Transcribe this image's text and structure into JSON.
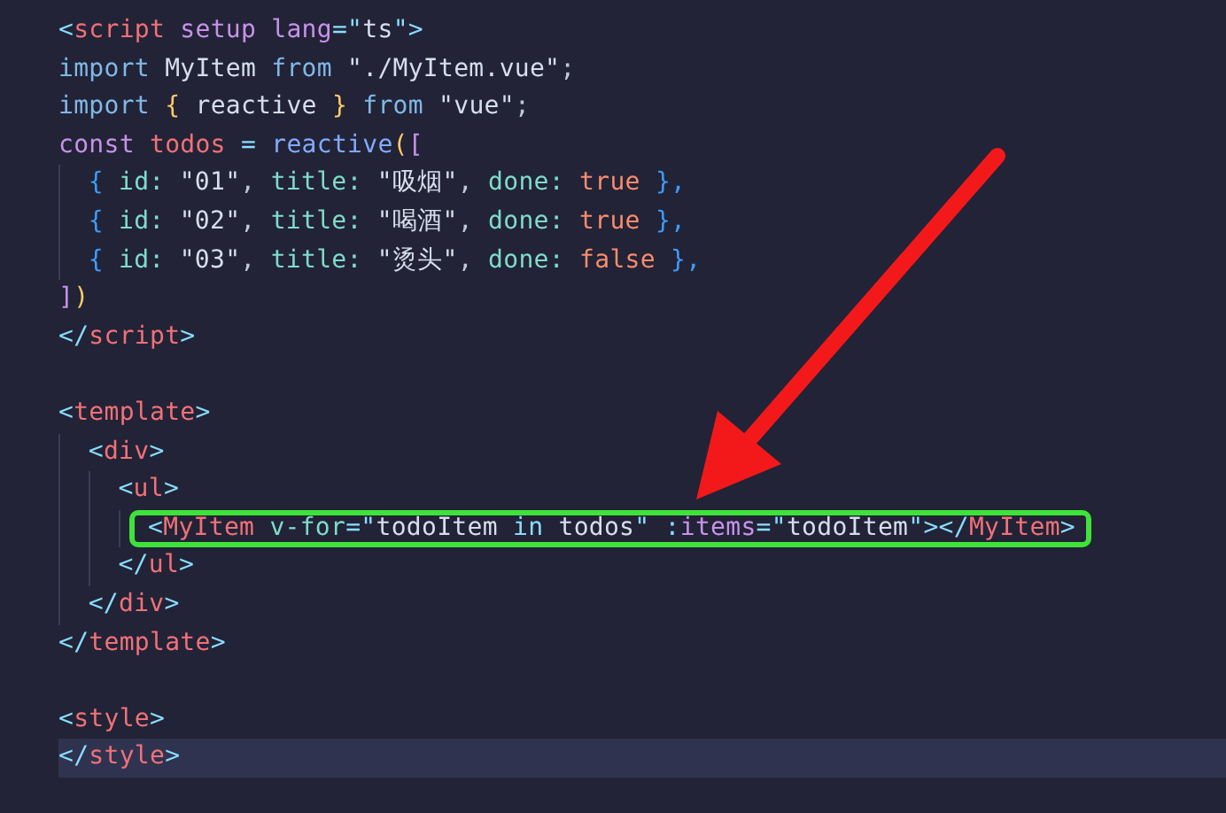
{
  "editor": {
    "lines": [
      {
        "tokens": [
          {
            "text": "<",
            "kind": "punct"
          },
          {
            "text": "script",
            "kind": "tag"
          },
          {
            "text": " setup",
            "kind": "attr"
          },
          {
            "text": " lang",
            "kind": "attr"
          },
          {
            "text": "=\"",
            "kind": "punct"
          },
          {
            "text": "ts",
            "kind": "str"
          },
          {
            "text": "\">",
            "kind": "punct"
          }
        ],
        "current": false,
        "highlighted": false
      },
      {
        "tokens": [
          {
            "text": "import",
            "kind": "kw"
          },
          {
            "text": " MyItem ",
            "kind": "ident"
          },
          {
            "text": "from",
            "kind": "kw"
          },
          {
            "text": " \"./MyItem.vue\"",
            "kind": "str"
          },
          {
            "text": ";",
            "kind": "plain"
          }
        ],
        "current": false,
        "highlighted": false
      },
      {
        "tokens": [
          {
            "text": "import",
            "kind": "kw"
          },
          {
            "text": " {",
            "kind": "brace"
          },
          {
            "text": " reactive ",
            "kind": "ident"
          },
          {
            "text": "}",
            "kind": "brace"
          },
          {
            "text": " from",
            "kind": "kw"
          },
          {
            "text": " \"vue\"",
            "kind": "str"
          },
          {
            "text": ";",
            "kind": "plain"
          }
        ],
        "current": false,
        "highlighted": false
      },
      {
        "tokens": [
          {
            "text": "const",
            "kind": "keyword"
          },
          {
            "text": " todos",
            "kind": "var"
          },
          {
            "text": " = ",
            "kind": "punct"
          },
          {
            "text": "reactive",
            "kind": "fn"
          },
          {
            "text": "(",
            "kind": "brace"
          },
          {
            "text": "[",
            "kind": "bracket"
          }
        ],
        "current": false,
        "highlighted": false
      },
      {
        "tokens": [
          {
            "text": "  {",
            "kind": "brace2"
          },
          {
            "text": " id: ",
            "kind": "prop"
          },
          {
            "text": "\"01\"",
            "kind": "str"
          },
          {
            "text": ", ",
            "kind": "plain"
          },
          {
            "text": "title: ",
            "kind": "prop"
          },
          {
            "text": "\"吸烟\"",
            "kind": "str"
          },
          {
            "text": ", ",
            "kind": "plain"
          },
          {
            "text": "done: ",
            "kind": "prop"
          },
          {
            "text": "true",
            "kind": "bool"
          },
          {
            "text": " },",
            "kind": "brace2"
          }
        ],
        "current": false,
        "highlighted": false
      },
      {
        "tokens": [
          {
            "text": "  {",
            "kind": "brace2"
          },
          {
            "text": " id: ",
            "kind": "prop"
          },
          {
            "text": "\"02\"",
            "kind": "str"
          },
          {
            "text": ", ",
            "kind": "plain"
          },
          {
            "text": "title: ",
            "kind": "prop"
          },
          {
            "text": "\"喝酒\"",
            "kind": "str"
          },
          {
            "text": ", ",
            "kind": "plain"
          },
          {
            "text": "done: ",
            "kind": "prop"
          },
          {
            "text": "true",
            "kind": "bool"
          },
          {
            "text": " },",
            "kind": "brace2"
          }
        ],
        "current": false,
        "highlighted": false
      },
      {
        "tokens": [
          {
            "text": "  {",
            "kind": "brace2"
          },
          {
            "text": " id: ",
            "kind": "prop"
          },
          {
            "text": "\"03\"",
            "kind": "str"
          },
          {
            "text": ", ",
            "kind": "plain"
          },
          {
            "text": "title: ",
            "kind": "prop"
          },
          {
            "text": "\"烫头\"",
            "kind": "str"
          },
          {
            "text": ", ",
            "kind": "plain"
          },
          {
            "text": "done: ",
            "kind": "prop"
          },
          {
            "text": "false",
            "kind": "bool"
          },
          {
            "text": " },",
            "kind": "brace2"
          }
        ],
        "current": false,
        "highlighted": false
      },
      {
        "tokens": [
          {
            "text": "]",
            "kind": "bracket"
          },
          {
            "text": ")",
            "kind": "brace"
          }
        ],
        "current": false,
        "highlighted": false
      },
      {
        "tokens": [
          {
            "text": "</",
            "kind": "punct"
          },
          {
            "text": "script",
            "kind": "tag"
          },
          {
            "text": ">",
            "kind": "punct"
          }
        ],
        "current": false,
        "highlighted": false
      },
      {
        "current": false,
        "highlighted": false
      },
      {
        "tokens": [
          {
            "text": "<",
            "kind": "punct"
          },
          {
            "text": "template",
            "kind": "tag"
          },
          {
            "text": ">",
            "kind": "punct"
          }
        ],
        "current": false,
        "highlighted": false
      },
      {
        "tokens": [
          {
            "text": "  <",
            "kind": "punct"
          },
          {
            "text": "div",
            "kind": "tag"
          },
          {
            "text": ">",
            "kind": "punct"
          }
        ],
        "current": false,
        "highlighted": false
      },
      {
        "tokens": [
          {
            "text": "    <",
            "kind": "punct"
          },
          {
            "text": "ul",
            "kind": "tag"
          },
          {
            "text": ">",
            "kind": "punct"
          }
        ],
        "current": false,
        "highlighted": false
      },
      {
        "tokens": [
          {
            "text": "      <",
            "kind": "punct"
          },
          {
            "text": "MyItem",
            "kind": "tag"
          },
          {
            "text": " v-for",
            "kind": "prop"
          },
          {
            "text": "=\"",
            "kind": "punct"
          },
          {
            "text": "todoItem ",
            "kind": "str"
          },
          {
            "text": "in",
            "kind": "kwb"
          },
          {
            "text": " todos",
            "kind": "str"
          },
          {
            "text": "\" :",
            "kind": "punct"
          },
          {
            "text": "items",
            "kind": "attr"
          },
          {
            "text": "=\"",
            "kind": "punct"
          },
          {
            "text": "todoItem",
            "kind": "str"
          },
          {
            "text": "\"></",
            "kind": "punct"
          },
          {
            "text": "MyItem",
            "kind": "tag"
          },
          {
            "text": ">",
            "kind": "punct"
          }
        ],
        "current": false,
        "highlighted": true
      },
      {
        "tokens": [
          {
            "text": "    </",
            "kind": "punct"
          },
          {
            "text": "ul",
            "kind": "tag"
          },
          {
            "text": ">",
            "kind": "punct"
          }
        ],
        "current": false,
        "highlighted": false
      },
      {
        "tokens": [
          {
            "text": "  </",
            "kind": "punct"
          },
          {
            "text": "div",
            "kind": "tag"
          },
          {
            "text": ">",
            "kind": "punct"
          }
        ],
        "current": false,
        "highlighted": false
      },
      {
        "tokens": [
          {
            "text": "</",
            "kind": "punct"
          },
          {
            "text": "template",
            "kind": "tag"
          },
          {
            "text": ">",
            "kind": "punct"
          }
        ],
        "current": false,
        "highlighted": false
      },
      {
        "current": false,
        "highlighted": false
      },
      {
        "tokens": [
          {
            "text": "<",
            "kind": "punct"
          },
          {
            "text": "style",
            "kind": "tag"
          },
          {
            "text": ">",
            "kind": "punct"
          }
        ],
        "current": false,
        "highlighted": false
      },
      {
        "tokens": [
          {
            "text": "</",
            "kind": "punct"
          },
          {
            "text": "style",
            "kind": "tag"
          },
          {
            "text": ">",
            "kind": "punct"
          }
        ],
        "current": true,
        "highlighted": false
      }
    ]
  }
}
